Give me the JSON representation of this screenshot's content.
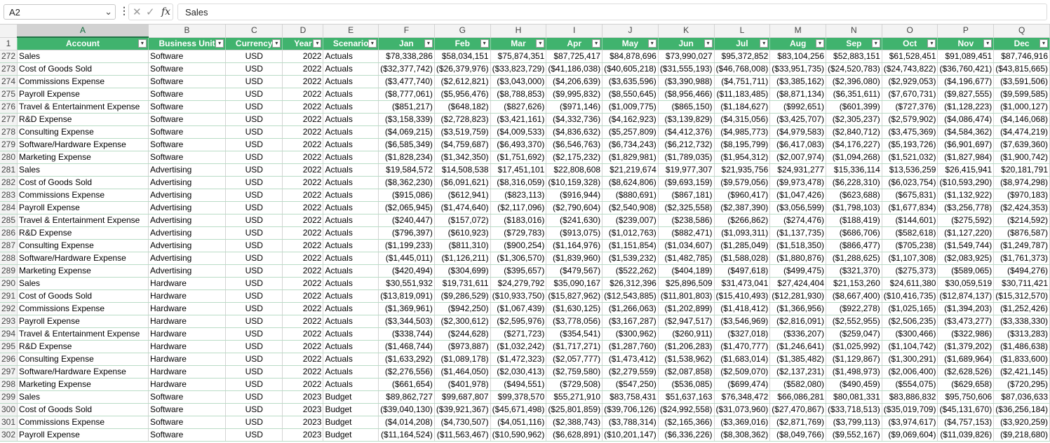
{
  "formula_bar": {
    "name_box": "A2",
    "formula": "Sales"
  },
  "column_letters": [
    "A",
    "B",
    "C",
    "D",
    "E",
    "F",
    "G",
    "H",
    "I",
    "J",
    "K",
    "L",
    "M",
    "N",
    "O",
    "P",
    "Q"
  ],
  "header_row_number": "1",
  "headers": [
    "Account",
    "Business Unit",
    "Currency",
    "Year",
    "Scenario",
    "Jan",
    "Feb",
    "Mar",
    "Apr",
    "May",
    "Jun",
    "Jul",
    "Aug",
    "Sep",
    "Oct",
    "Nov",
    "Dec"
  ],
  "rows": [
    {
      "n": "272",
      "cells": [
        "Sales",
        "Software",
        "USD",
        "2022",
        "Actuals",
        "$78,338,286",
        "$58,034,151",
        "$75,874,351",
        "$87,725,417",
        "$84,878,696",
        "$73,990,027",
        "$95,372,852",
        "$83,104,256",
        "$52,883,151",
        "$61,528,451",
        "$91,089,451",
        "$87,746,916"
      ]
    },
    {
      "n": "273",
      "cells": [
        "Cost of Goods Sold",
        "Software",
        "USD",
        "2022",
        "Actuals",
        "($32,377,742)",
        "($26,379,976)",
        "($33,823,729)",
        "($41,186,038)",
        "($40,605,218)",
        "($31,555,193)",
        "($46,768,008)",
        "($33,951,735)",
        "($24,520,783)",
        "($24,743,822)",
        "($36,760,421)",
        "($43,815,665)"
      ]
    },
    {
      "n": "274",
      "cells": [
        "Commissions Expense",
        "Software",
        "USD",
        "2022",
        "Actuals",
        "($3,477,740)",
        "($2,612,821)",
        "($3,043,000)",
        "($4,206,639)",
        "($3,635,596)",
        "($3,390,988)",
        "($4,751,711)",
        "($3,385,162)",
        "($2,396,080)",
        "($2,929,053)",
        "($4,196,677)",
        "($3,591,506)"
      ]
    },
    {
      "n": "275",
      "cells": [
        "Payroll Expense",
        "Software",
        "USD",
        "2022",
        "Actuals",
        "($8,777,061)",
        "($5,956,476)",
        "($8,788,853)",
        "($9,995,832)",
        "($8,550,645)",
        "($8,956,466)",
        "($11,183,485)",
        "($8,871,134)",
        "($6,351,611)",
        "($7,670,731)",
        "($9,827,555)",
        "($9,599,585)"
      ]
    },
    {
      "n": "276",
      "cells": [
        "Travel & Entertainment Expense",
        "Software",
        "USD",
        "2022",
        "Actuals",
        "($851,217)",
        "($648,182)",
        "($827,626)",
        "($971,146)",
        "($1,009,775)",
        "($865,150)",
        "($1,184,627)",
        "($992,651)",
        "($601,399)",
        "($727,376)",
        "($1,128,223)",
        "($1,000,127)"
      ]
    },
    {
      "n": "277",
      "cells": [
        "R&D Expense",
        "Software",
        "USD",
        "2022",
        "Actuals",
        "($3,158,339)",
        "($2,728,823)",
        "($3,421,161)",
        "($4,332,736)",
        "($4,162,923)",
        "($3,139,829)",
        "($4,315,056)",
        "($3,425,707)",
        "($2,305,237)",
        "($2,579,902)",
        "($4,086,474)",
        "($4,146,068)"
      ]
    },
    {
      "n": "278",
      "cells": [
        "Consulting Expense",
        "Software",
        "USD",
        "2022",
        "Actuals",
        "($4,069,215)",
        "($3,519,759)",
        "($4,009,533)",
        "($4,836,632)",
        "($5,257,809)",
        "($4,412,376)",
        "($4,985,773)",
        "($4,979,583)",
        "($2,840,712)",
        "($3,475,369)",
        "($4,584,362)",
        "($4,474,219)"
      ]
    },
    {
      "n": "279",
      "cells": [
        "Software/Hardware Expense",
        "Software",
        "USD",
        "2022",
        "Actuals",
        "($6,585,349)",
        "($4,759,687)",
        "($6,493,370)",
        "($6,546,763)",
        "($6,734,243)",
        "($6,212,732)",
        "($8,195,799)",
        "($6,417,083)",
        "($4,176,227)",
        "($5,193,726)",
        "($6,901,697)",
        "($7,639,360)"
      ]
    },
    {
      "n": "280",
      "cells": [
        "Marketing Expense",
        "Software",
        "USD",
        "2022",
        "Actuals",
        "($1,828,234)",
        "($1,342,350)",
        "($1,751,692)",
        "($2,175,232)",
        "($1,829,981)",
        "($1,789,035)",
        "($1,954,312)",
        "($2,007,974)",
        "($1,094,268)",
        "($1,521,032)",
        "($1,827,984)",
        "($1,900,742)"
      ]
    },
    {
      "n": "281",
      "cells": [
        "Sales",
        "Advertising",
        "USD",
        "2022",
        "Actuals",
        "$19,584,572",
        "$14,508,538",
        "$17,451,101",
        "$22,808,608",
        "$21,219,674",
        "$19,977,307",
        "$21,935,756",
        "$24,931,277",
        "$15,336,114",
        "$13,536,259",
        "$26,415,941",
        "$20,181,791"
      ]
    },
    {
      "n": "282",
      "cells": [
        "Cost of Goods Sold",
        "Advertising",
        "USD",
        "2022",
        "Actuals",
        "($8,362,230)",
        "($6,091,621)",
        "($8,316,059)",
        "($10,159,328)",
        "($8,624,806)",
        "($9,693,159)",
        "($9,579,056)",
        "($9,973,478)",
        "($6,228,310)",
        "($6,023,754)",
        "($10,593,290)",
        "($8,974,298)"
      ]
    },
    {
      "n": "283",
      "cells": [
        "Commissions Expense",
        "Advertising",
        "USD",
        "2022",
        "Actuals",
        "($915,086)",
        "($612,941)",
        "($823,113)",
        "($916,944)",
        "($880,691)",
        "($867,181)",
        "($960,417)",
        "($1,047,426)",
        "($623,688)",
        "($675,831)",
        "($1,132,922)",
        "($970,183)"
      ]
    },
    {
      "n": "284",
      "cells": [
        "Payroll Expense",
        "Advertising",
        "USD",
        "2022",
        "Actuals",
        "($2,065,945)",
        "($1,474,640)",
        "($2,117,096)",
        "($2,790,604)",
        "($2,540,908)",
        "($2,325,558)",
        "($2,387,390)",
        "($3,056,599)",
        "($1,798,103)",
        "($1,677,834)",
        "($3,256,778)",
        "($2,424,353)"
      ]
    },
    {
      "n": "285",
      "cells": [
        "Travel & Entertainment Expense",
        "Advertising",
        "USD",
        "2022",
        "Actuals",
        "($240,447)",
        "($157,072)",
        "($183,016)",
        "($241,630)",
        "($239,007)",
        "($238,586)",
        "($266,862)",
        "($274,476)",
        "($188,419)",
        "($144,601)",
        "($275,592)",
        "($214,592)"
      ]
    },
    {
      "n": "286",
      "cells": [
        "R&D Expense",
        "Advertising",
        "USD",
        "2022",
        "Actuals",
        "($796,397)",
        "($610,923)",
        "($729,783)",
        "($913,075)",
        "($1,012,763)",
        "($882,471)",
        "($1,093,311)",
        "($1,137,735)",
        "($686,706)",
        "($582,618)",
        "($1,127,220)",
        "($876,587)"
      ]
    },
    {
      "n": "287",
      "cells": [
        "Consulting Expense",
        "Advertising",
        "USD",
        "2022",
        "Actuals",
        "($1,199,233)",
        "($811,310)",
        "($900,254)",
        "($1,164,976)",
        "($1,151,854)",
        "($1,034,607)",
        "($1,285,049)",
        "($1,518,350)",
        "($866,477)",
        "($705,238)",
        "($1,549,744)",
        "($1,249,787)"
      ]
    },
    {
      "n": "288",
      "cells": [
        "Software/Hardware Expense",
        "Advertising",
        "USD",
        "2022",
        "Actuals",
        "($1,445,011)",
        "($1,126,211)",
        "($1,306,570)",
        "($1,839,960)",
        "($1,539,232)",
        "($1,482,785)",
        "($1,588,028)",
        "($1,880,876)",
        "($1,288,625)",
        "($1,107,308)",
        "($2,083,925)",
        "($1,761,373)"
      ]
    },
    {
      "n": "289",
      "cells": [
        "Marketing Expense",
        "Advertising",
        "USD",
        "2022",
        "Actuals",
        "($420,494)",
        "($304,699)",
        "($395,657)",
        "($479,567)",
        "($522,262)",
        "($404,189)",
        "($497,618)",
        "($499,475)",
        "($321,370)",
        "($275,373)",
        "($589,065)",
        "($494,276)"
      ]
    },
    {
      "n": "290",
      "cells": [
        "Sales",
        "Hardware",
        "USD",
        "2022",
        "Actuals",
        "$30,551,932",
        "$19,731,611",
        "$24,279,792",
        "$35,090,167",
        "$26,312,396",
        "$25,896,509",
        "$31,473,041",
        "$27,424,404",
        "$21,153,260",
        "$24,611,380",
        "$30,059,519",
        "$30,711,421"
      ]
    },
    {
      "n": "291",
      "cells": [
        "Cost of Goods Sold",
        "Hardware",
        "USD",
        "2022",
        "Actuals",
        "($13,819,091)",
        "($9,286,529)",
        "($10,933,750)",
        "($15,827,962)",
        "($12,543,885)",
        "($11,801,803)",
        "($15,410,493)",
        "($12,281,930)",
        "($8,667,400)",
        "($10,416,735)",
        "($12,874,137)",
        "($15,312,570)"
      ]
    },
    {
      "n": "292",
      "cells": [
        "Commissions Expense",
        "Hardware",
        "USD",
        "2022",
        "Actuals",
        "($1,369,961)",
        "($942,250)",
        "($1,067,439)",
        "($1,630,125)",
        "($1,266,063)",
        "($1,202,899)",
        "($1,418,412)",
        "($1,366,956)",
        "($922,278)",
        "($1,025,165)",
        "($1,394,203)",
        "($1,252,426)"
      ]
    },
    {
      "n": "293",
      "cells": [
        "Payroll Expense",
        "Hardware",
        "USD",
        "2022",
        "Actuals",
        "($3,344,503)",
        "($2,300,612)",
        "($2,595,976)",
        "($3,778,056)",
        "($3,167,287)",
        "($2,947,517)",
        "($3,546,969)",
        "($2,816,091)",
        "($2,552,955)",
        "($2,506,235)",
        "($3,473,277)",
        "($3,338,330)"
      ]
    },
    {
      "n": "294",
      "cells": [
        "Travel & Entertainment Expense",
        "Hardware",
        "USD",
        "2022",
        "Actuals",
        "($338,744)",
        "($244,628)",
        "($271,723)",
        "($354,541)",
        "($300,962)",
        "($260,911)",
        "($327,018)",
        "($336,207)",
        "($259,047)",
        "($300,466)",
        "($322,986)",
        "($313,283)"
      ]
    },
    {
      "n": "295",
      "cells": [
        "R&D Expense",
        "Hardware",
        "USD",
        "2022",
        "Actuals",
        "($1,468,744)",
        "($973,887)",
        "($1,032,242)",
        "($1,717,271)",
        "($1,287,760)",
        "($1,206,283)",
        "($1,470,777)",
        "($1,246,641)",
        "($1,025,992)",
        "($1,104,742)",
        "($1,379,202)",
        "($1,486,638)"
      ]
    },
    {
      "n": "296",
      "cells": [
        "Consulting Expense",
        "Hardware",
        "USD",
        "2022",
        "Actuals",
        "($1,633,292)",
        "($1,089,178)",
        "($1,472,323)",
        "($2,057,777)",
        "($1,473,412)",
        "($1,538,962)",
        "($1,683,014)",
        "($1,385,482)",
        "($1,129,867)",
        "($1,300,291)",
        "($1,689,964)",
        "($1,833,600)"
      ]
    },
    {
      "n": "297",
      "cells": [
        "Software/Hardware Expense",
        "Hardware",
        "USD",
        "2022",
        "Actuals",
        "($2,276,556)",
        "($1,464,050)",
        "($2,030,413)",
        "($2,759,580)",
        "($2,279,559)",
        "($2,087,858)",
        "($2,509,070)",
        "($2,137,231)",
        "($1,498,973)",
        "($2,006,400)",
        "($2,628,526)",
        "($2,421,145)"
      ]
    },
    {
      "n": "298",
      "cells": [
        "Marketing Expense",
        "Hardware",
        "USD",
        "2022",
        "Actuals",
        "($661,654)",
        "($401,978)",
        "($494,551)",
        "($729,508)",
        "($547,250)",
        "($536,085)",
        "($699,474)",
        "($582,080)",
        "($490,459)",
        "($554,075)",
        "($629,658)",
        "($720,295)"
      ]
    },
    {
      "n": "299",
      "cells": [
        "Sales",
        "Software",
        "USD",
        "2023",
        "Budget",
        "$89,862,727",
        "$99,687,807",
        "$99,378,570",
        "$55,271,910",
        "$83,758,431",
        "$51,637,163",
        "$76,348,472",
        "$66,086,281",
        "$80,081,331",
        "$83,886,832",
        "$95,750,606",
        "$87,036,633"
      ]
    },
    {
      "n": "300",
      "cells": [
        "Cost of Goods Sold",
        "Software",
        "USD",
        "2023",
        "Budget",
        "($39,040,130)",
        "($39,921,367)",
        "($45,671,498)",
        "($25,801,859)",
        "($39,706,126)",
        "($24,992,558)",
        "($31,073,960)",
        "($27,470,867)",
        "($33,718,513)",
        "($35,019,709)",
        "($45,131,670)",
        "($36,256,184)"
      ]
    },
    {
      "n": "301",
      "cells": [
        "Commissions Expense",
        "Software",
        "USD",
        "2023",
        "Budget",
        "($4,014,208)",
        "($4,730,507)",
        "($4,051,116)",
        "($2,388,743)",
        "($3,788,314)",
        "($2,165,366)",
        "($3,369,016)",
        "($2,871,769)",
        "($3,799,113)",
        "($3,974,617)",
        "($4,757,153)",
        "($3,920,259)"
      ]
    },
    {
      "n": "302",
      "cells": [
        "Payroll Expense",
        "Software",
        "USD",
        "2023",
        "Budget",
        "($11,164,524)",
        "($11,563,467)",
        "($10,590,962)",
        "($6,628,891)",
        "($10,201,147)",
        "($6,336,226)",
        "($8,308,362)",
        "($8,049,766)",
        "($9,552,167)",
        "($9,069,604)",
        "($11,039,826)",
        "($9,218,680)"
      ]
    }
  ]
}
